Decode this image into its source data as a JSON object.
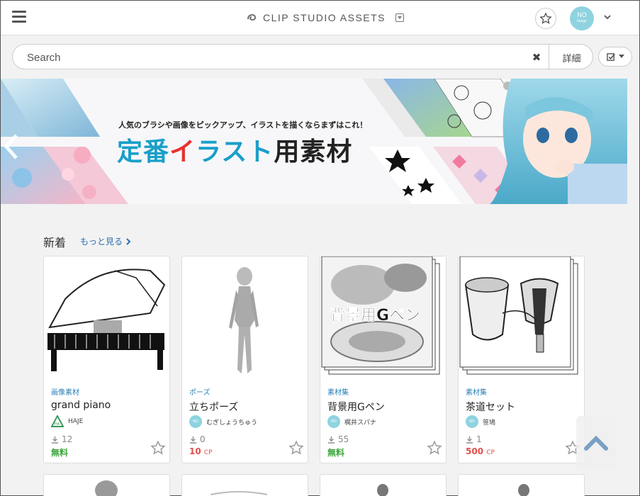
{
  "header": {
    "brand": "CLIP STUDIO ASSETS",
    "avatar_text": "NO",
    "avatar_sub": "image"
  },
  "search": {
    "placeholder": "Search",
    "clear_label": "✖",
    "detail_label": "詳細"
  },
  "banner": {
    "subtitle": "人気のブラシや画像をピックアップ、イラストを描くならまずはこれ！",
    "title_part1": "定番",
    "title_part2": "イ",
    "title_part3": "ラスト",
    "title_part4": "用素材"
  },
  "section": {
    "title": "新着",
    "more": "もっと見る"
  },
  "cards": [
    {
      "category": "画像素材",
      "name": "grand piano",
      "author": "HAJE",
      "downloads": "12",
      "price": "無料",
      "price_unit": "",
      "price_type": "free"
    },
    {
      "category": "ポーズ",
      "name": "立ちポーズ",
      "author": "むぎしょうちゅう",
      "downloads": "0",
      "price": "10",
      "price_unit": "CP",
      "price_type": "cp"
    },
    {
      "category": "素材集",
      "name": "背景用Gペン",
      "author": "梶井スパナ",
      "downloads": "55",
      "price": "無料",
      "price_unit": "",
      "price_type": "free",
      "thumb_text": "背景用Gペン"
    },
    {
      "category": "素材集",
      "name": "茶道セット",
      "author": "笹鳩",
      "downloads": "1",
      "price": "500",
      "price_unit": "CP",
      "price_type": "cp"
    }
  ],
  "colors": {
    "accent_blue": "#1a9fc9",
    "accent_red": "#e8302f",
    "free_green": "#3aa53a",
    "cp_red": "#e0504a",
    "avatar_teal": "#8fd3e0"
  }
}
